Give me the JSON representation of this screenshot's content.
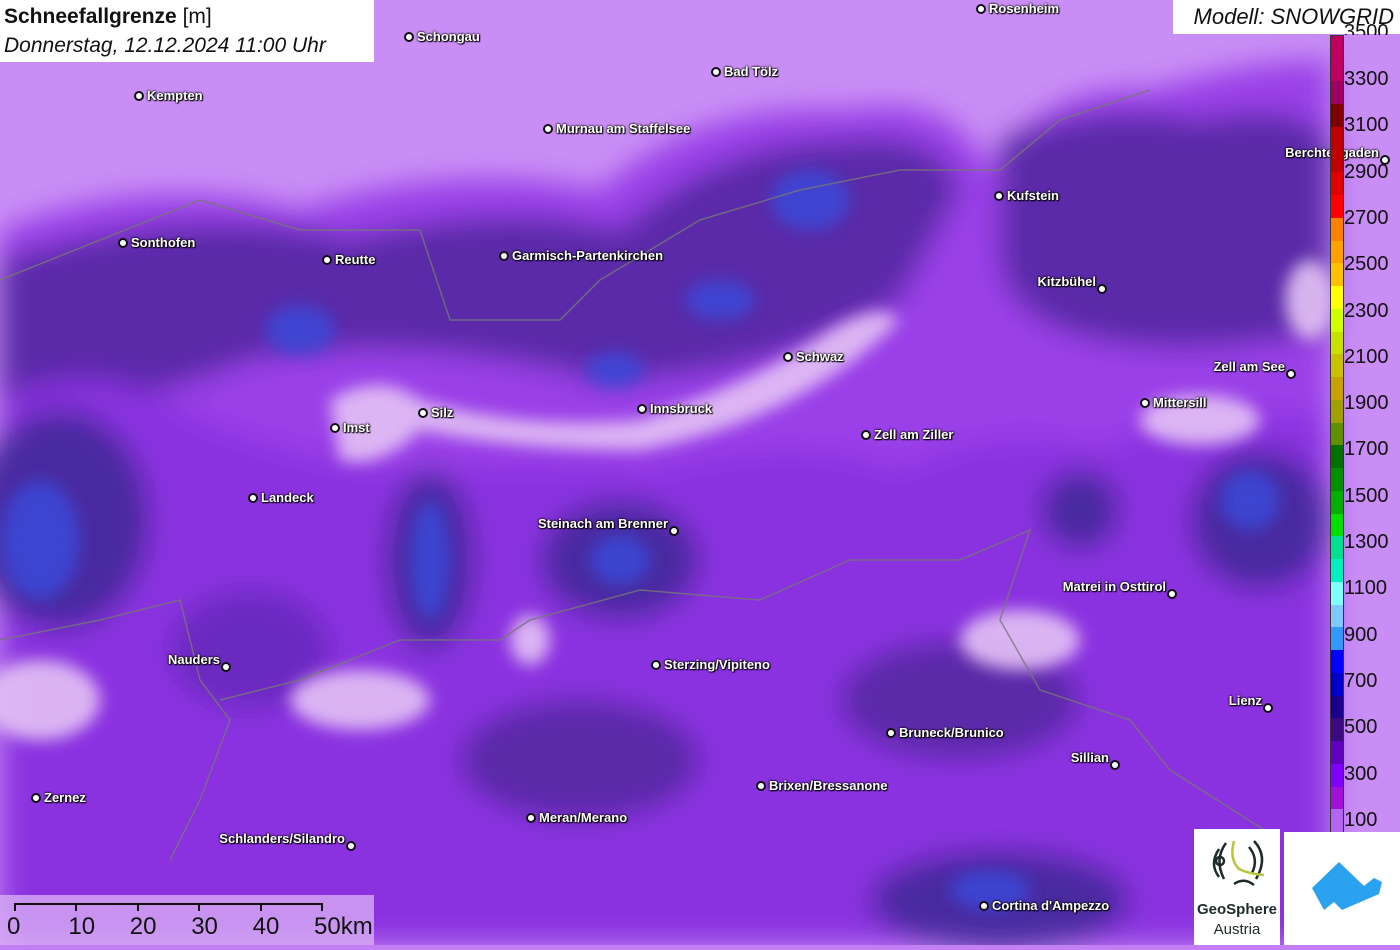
{
  "header": {
    "title": "Schneefallgrenze",
    "unit": "[m]",
    "datetime": "Donnerstag, 12.12.2024 11:00 Uhr"
  },
  "model": "Modell: SNOWGRID",
  "legend": {
    "labels": [
      "3300",
      "3100",
      "2900",
      "2700",
      "2500",
      "2300",
      "2100",
      "1900",
      "1700",
      "1500",
      "1300",
      "1100",
      "900",
      "700",
      "500",
      "300",
      "100"
    ],
    "top_partial": "3500",
    "colors": [
      "#b464f5",
      "#a010d8",
      "#8000ff",
      "#6000c0",
      "#3c0a80",
      "#1a0090",
      "#0000c8",
      "#0000ff",
      "#3399ff",
      "#80c8ff",
      "#80ffff",
      "#00f0c0",
      "#00e090",
      "#00e000",
      "#00b000",
      "#009000",
      "#007000",
      "#609000",
      "#a0a000",
      "#c8a000",
      "#c8c000",
      "#c8e000",
      "#d0ff00",
      "#ffff00",
      "#ffc000",
      "#ffa000",
      "#ff8000",
      "#ff0000",
      "#e00000",
      "#c00000",
      "#c00000",
      "#800000",
      "#a00060",
      "#c00060",
      "#c00060"
    ]
  },
  "cities": [
    {
      "name": "Rosenheim"
    },
    {
      "name": "Schongau"
    },
    {
      "name": "Kempten"
    },
    {
      "name": "Bad Tölz"
    },
    {
      "name": "Murnau am Staffelsee"
    },
    {
      "name": "Berchtesgaden"
    },
    {
      "name": "Kufstein"
    },
    {
      "name": "Sonthofen"
    },
    {
      "name": "Reutte"
    },
    {
      "name": "Garmisch-Partenkirchen"
    },
    {
      "name": "Kitzbühel"
    },
    {
      "name": "Schwaz"
    },
    {
      "name": "Zell am See"
    },
    {
      "name": "Mittersill"
    },
    {
      "name": "Imst"
    },
    {
      "name": "Silz"
    },
    {
      "name": "Innsbruck"
    },
    {
      "name": "Zell am Ziller"
    },
    {
      "name": "Landeck"
    },
    {
      "name": "Steinach am Brenner"
    },
    {
      "name": "Matrei in Osttirol"
    },
    {
      "name": "Nauders"
    },
    {
      "name": "Sterzing/Vipiteno"
    },
    {
      "name": "Lienz"
    },
    {
      "name": "Bruneck/Brunico"
    },
    {
      "name": "Sillian"
    },
    {
      "name": "Brixen/Bressanone"
    },
    {
      "name": "Zernez"
    },
    {
      "name": "Meran/Merano"
    },
    {
      "name": "Schlanders/Silandro"
    },
    {
      "name": "Cortina d'Ampezzo"
    }
  ],
  "scalebar": {
    "ticks": [
      "0",
      "10",
      "20",
      "30",
      "40",
      "50km"
    ]
  },
  "logos": {
    "geosphere_line1": "GeoSphere",
    "geosphere_line2": "Austria"
  }
}
